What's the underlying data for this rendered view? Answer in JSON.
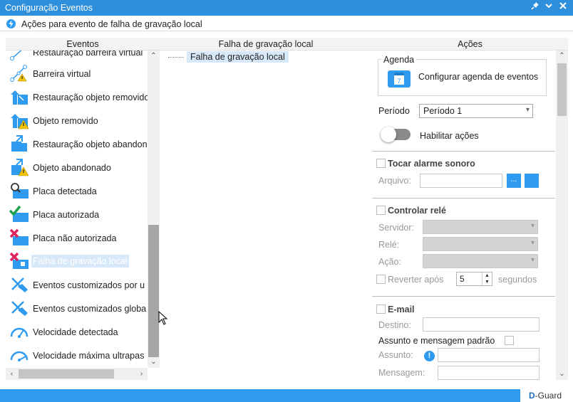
{
  "window": {
    "title": "Configuração Eventos",
    "controls": {
      "pin_icon": "pin-icon",
      "minimize_icon": "chevron-down-icon",
      "close_icon": "close-icon"
    }
  },
  "subtitle": {
    "label": "Ações para evento de falha de gravação local",
    "icon": "lightning-gear-icon"
  },
  "columns": {
    "events": "Eventos",
    "tree": "Falha de gravação local",
    "actions": "Ações"
  },
  "events": [
    {
      "label": "Restauração barreira virtual",
      "icon": "virtual-barrier-restore-icon"
    },
    {
      "label": "Barreira virtual",
      "icon": "virtual-barrier-icon"
    },
    {
      "label": "Restauração objeto removido",
      "icon": "object-removed-restore-icon"
    },
    {
      "label": "Objeto removido",
      "icon": "object-removed-icon"
    },
    {
      "label": "Restauração objeto abandonado",
      "icon": "object-abandoned-restore-icon"
    },
    {
      "label": "Objeto abandonado",
      "icon": "object-abandoned-icon"
    },
    {
      "label": "Placa detectada",
      "icon": "plate-detected-icon"
    },
    {
      "label": "Placa autorizada",
      "icon": "plate-authorized-icon"
    },
    {
      "label": "Placa não autorizada",
      "icon": "plate-unauthorized-icon"
    },
    {
      "label": "Falha de gravação local",
      "icon": "local-recording-failure-icon",
      "selected": true
    },
    {
      "label": "Eventos customizados por u",
      "icon": "custom-events-user-icon"
    },
    {
      "label": "Eventos customizados globa",
      "icon": "custom-events-global-icon"
    },
    {
      "label": "Velocidade detectada",
      "icon": "speed-detected-icon"
    },
    {
      "label": "Velocidade máxima ultrapas",
      "icon": "speed-exceeded-icon"
    }
  ],
  "tree": {
    "item": "Falha de gravação local"
  },
  "actions": {
    "agenda": {
      "legend": "Agenda",
      "button_label": "Configurar agenda de eventos",
      "calendar_day": "7"
    },
    "period": {
      "label": "Período",
      "value": "Período 1"
    },
    "enable_actions": {
      "label": "Habilitar ações",
      "on": false
    },
    "alarm": {
      "title": "Tocar alarme sonoro",
      "file_label": "Arquivo:",
      "browse_label": "..."
    },
    "relay": {
      "title": "Controlar relé",
      "server_label": "Servidor:",
      "relay_label": "Relé:",
      "action_label": "Ação:",
      "revert_label": "Reverter após",
      "revert_value": "5",
      "seconds_label": "segundos"
    },
    "email": {
      "title": "E-mail",
      "to_label": "Destino:",
      "default_label": "Assunto e mensagem padrão",
      "subject_label": "Assunto:",
      "message_label": "Mensagem:",
      "info_icon": "!"
    }
  },
  "status": {
    "brand_prefix": "D",
    "brand_suffix": "-Guard"
  },
  "colors": {
    "accent": "#2e9bf0",
    "title_bar": "#2e8fdc",
    "selection": "#d7e9f9"
  }
}
